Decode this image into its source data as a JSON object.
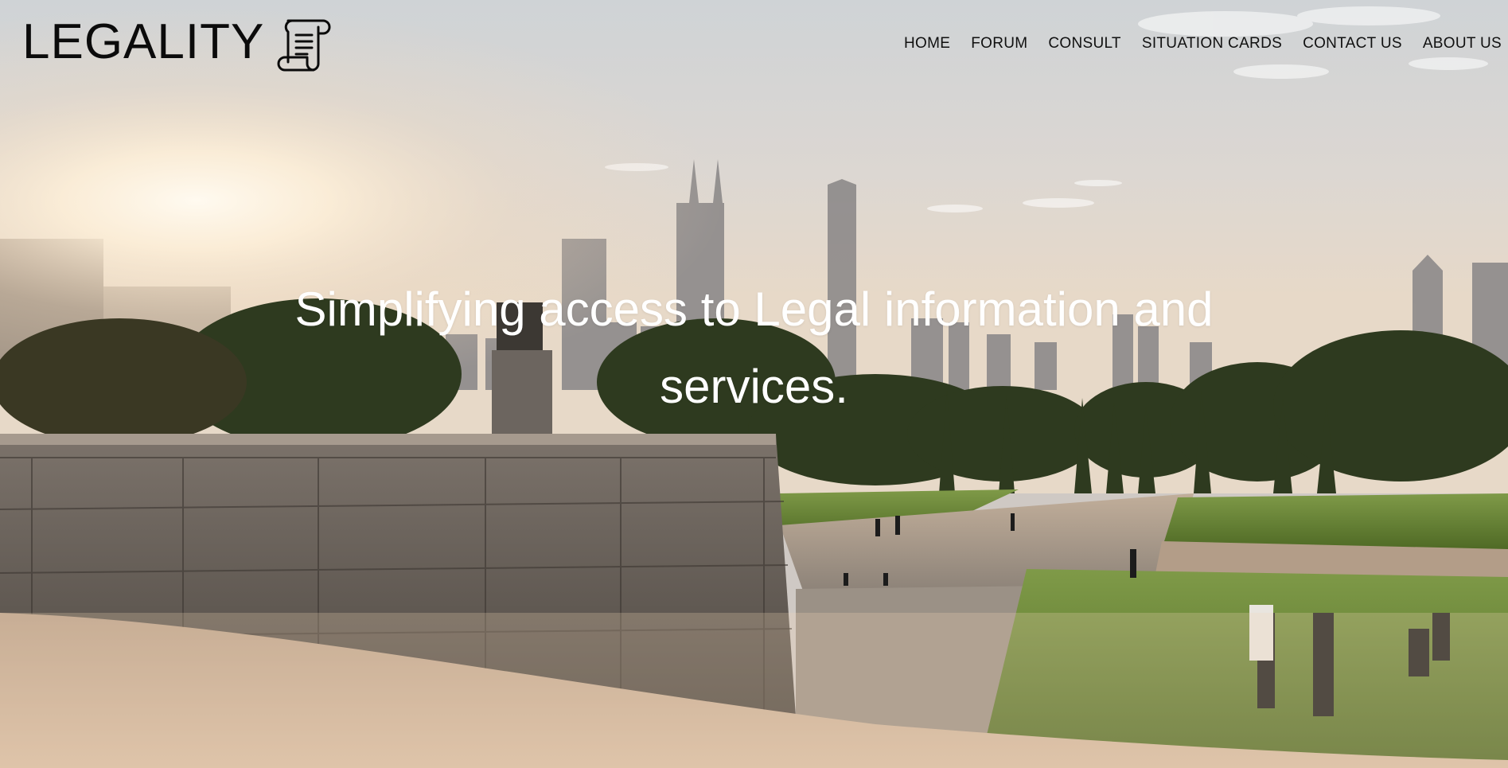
{
  "site": {
    "brand_name": "LEGALITY",
    "logo_icon": "scroll-document-icon"
  },
  "nav": {
    "items": [
      {
        "label": "HOME"
      },
      {
        "label": "FORUM"
      },
      {
        "label": "CONSULT"
      },
      {
        "label": "SITUATION CARDS"
      },
      {
        "label": "CONTACT US"
      },
      {
        "label": "ABOUT US"
      }
    ]
  },
  "hero": {
    "headline": "Simplifying access to Legal information and services.",
    "background_description_colors": {
      "sky": "#d9d4d0",
      "sun_glow": "#fff4e0",
      "foliage": "#2f3a22",
      "stone": "#6f6861",
      "lawn": "#6f8a3a",
      "path": "#a89a8c"
    }
  }
}
